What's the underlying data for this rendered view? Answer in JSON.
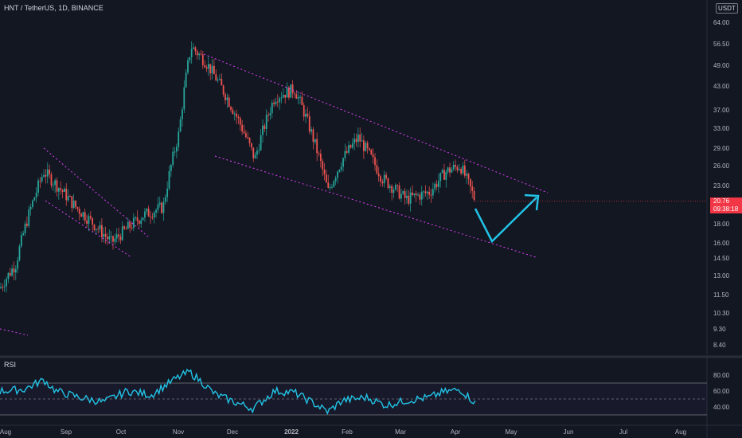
{
  "header": {
    "title": "HNT / TetherUS, 1D, BINANCE",
    "currency_button": "USDT"
  },
  "current_price": {
    "value": "20.76",
    "countdown": "09:38:18",
    "color": "#f23645"
  },
  "rsi": {
    "label": "RSI",
    "ticks": [
      "80.00",
      "60.00",
      "40.00"
    ],
    "color": "#22c3e6"
  },
  "colors": {
    "background": "#131722",
    "up": "#26a69a",
    "down": "#ef5350",
    "trendlines": "#e040fb",
    "arrow": "#22c3e6"
  },
  "chart_data": {
    "type": "candlestick",
    "title": "HNT / TetherUS, 1D, BINANCE",
    "yscale": "log",
    "y_tick_labels": [
      "64.00",
      "56.50",
      "49.00",
      "43.00",
      "37.00",
      "33.00",
      "29.00",
      "26.00",
      "23.00",
      "18.00",
      "16.00",
      "14.50",
      "13.00",
      "11.50",
      "10.30",
      "9.30",
      "8.40"
    ],
    "x_tick_labels": [
      "Aug",
      "Sep",
      "Oct",
      "Nov",
      "Dec",
      "2022",
      "Feb",
      "Mar",
      "Apr",
      "May",
      "Jun",
      "Jul",
      "Aug"
    ],
    "trend_path": [
      [
        "Aug",
        12.0
      ],
      [
        "Sep",
        24.0
      ],
      [
        "Oct",
        17.0
      ],
      [
        "Nov",
        50.0
      ],
      [
        "Dec",
        32.0
      ],
      [
        "2022",
        40.0
      ],
      [
        "Feb",
        27.0
      ],
      [
        "Mar",
        22.0
      ],
      [
        "Apr",
        25.0
      ],
      [
        "Apr",
        20.76
      ]
    ],
    "projection": [
      [
        "Apr",
        20.76
      ],
      [
        "May",
        16.2
      ],
      [
        "May",
        22.0
      ]
    ],
    "channels": [
      {
        "from": [
          "Nov",
          52.0
        ],
        "to": [
          "Jun",
          23.0
        ]
      },
      {
        "from": [
          "Nov",
          28.0
        ],
        "to": [
          "Jun",
          14.8
        ]
      }
    ],
    "rsi_range": [
      20,
      100
    ]
  }
}
